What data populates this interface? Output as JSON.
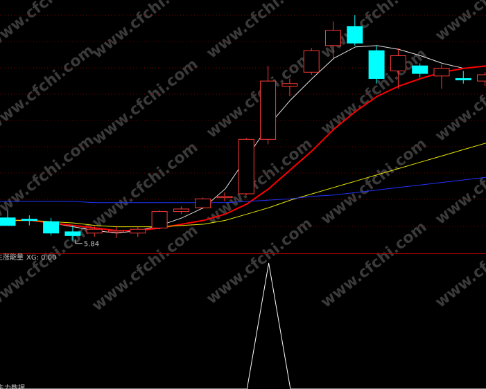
{
  "watermark": "www.cfchi.com",
  "colors": {
    "background": "#000000",
    "grid": "#7a0000",
    "separator": "#b00000",
    "up_candle": "#ff3a3a",
    "down_candle": "#00ffff",
    "ma_white": "#e6e6e6",
    "ma_red": "#ff0000",
    "ma_yellow": "#e8e800",
    "ma_blue": "#2233ff",
    "indicator": "#ffffff"
  },
  "chart_data": [
    {
      "type": "candlestick",
      "low_marker": "5.84",
      "candles": [
        {
          "o": 6.02,
          "h": 6.08,
          "l": 5.98,
          "c": 5.96
        },
        {
          "o": 6.01,
          "h": 6.04,
          "l": 5.96,
          "c": 6.0
        },
        {
          "o": 5.99,
          "h": 6.02,
          "l": 5.88,
          "c": 5.9
        },
        {
          "o": 5.91,
          "h": 5.96,
          "l": 5.84,
          "c": 5.88
        },
        {
          "o": 5.9,
          "h": 5.95,
          "l": 5.87,
          "c": 5.93
        },
        {
          "o": 5.92,
          "h": 5.95,
          "l": 5.86,
          "c": 5.92
        },
        {
          "o": 5.9,
          "h": 5.95,
          "l": 5.87,
          "c": 5.93
        },
        {
          "o": 5.94,
          "h": 6.08,
          "l": 5.93,
          "c": 6.07
        },
        {
          "o": 6.07,
          "h": 6.11,
          "l": 6.05,
          "c": 6.09
        },
        {
          "o": 6.1,
          "h": 6.18,
          "l": 6.09,
          "c": 6.17
        },
        {
          "o": 6.18,
          "h": 6.22,
          "l": 6.15,
          "c": 6.19
        },
        {
          "o": 6.21,
          "h": 6.65,
          "l": 6.2,
          "c": 6.64
        },
        {
          "o": 6.64,
          "h": 7.22,
          "l": 6.6,
          "c": 7.1
        },
        {
          "o": 7.06,
          "h": 7.12,
          "l": 6.98,
          "c": 7.08
        },
        {
          "o": 7.17,
          "h": 7.36,
          "l": 7.15,
          "c": 7.34
        },
        {
          "o": 7.38,
          "h": 7.57,
          "l": 7.28,
          "c": 7.5
        },
        {
          "o": 7.53,
          "h": 7.62,
          "l": 7.38,
          "c": 7.4
        },
        {
          "o": 7.34,
          "h": 7.38,
          "l": 7.08,
          "c": 7.12
        },
        {
          "o": 7.18,
          "h": 7.36,
          "l": 7.04,
          "c": 7.3
        },
        {
          "o": 7.22,
          "h": 7.24,
          "l": 7.13,
          "c": 7.16
        },
        {
          "o": 7.14,
          "h": 7.23,
          "l": 7.04,
          "c": 7.2
        },
        {
          "o": 7.12,
          "h": 7.18,
          "l": 7.08,
          "c": 7.11
        },
        {
          "o": 7.1,
          "h": 7.17,
          "l": 7.06,
          "c": 7.15
        },
        {
          "o": 7.2,
          "h": 7.34,
          "l": 7.12,
          "c": 7.31
        }
      ],
      "moving_averages": [
        {
          "color": "#e6e6e6",
          "values": [
            6.0,
            6.0,
            5.98,
            5.95,
            5.92,
            5.9,
            5.92,
            5.96,
            6.02,
            6.1,
            6.25,
            6.5,
            6.75,
            6.95,
            7.12,
            7.28,
            7.37,
            7.38,
            7.35,
            7.3,
            7.24,
            7.2,
            7.22,
            7.26
          ]
        },
        {
          "color": "#ff0000",
          "values": [
            6.0,
            6.0,
            5.98,
            5.96,
            5.94,
            5.92,
            5.92,
            5.94,
            5.97,
            6.0,
            6.05,
            6.13,
            6.25,
            6.4,
            6.55,
            6.72,
            6.86,
            6.98,
            7.06,
            7.12,
            7.17,
            7.2,
            7.22,
            7.24
          ]
        },
        {
          "color": "#e8e800",
          "values": [
            6.0,
            6.0,
            5.99,
            5.98,
            5.96,
            5.95,
            5.95,
            5.95,
            5.96,
            5.97,
            6.0,
            6.05,
            6.1,
            6.16,
            6.21,
            6.26,
            6.31,
            6.36,
            6.41,
            6.46,
            6.51,
            6.56,
            6.61,
            6.72
          ]
        },
        {
          "color": "#2233ff",
          "values": [
            6.15,
            6.15,
            6.15,
            6.15,
            6.14,
            6.14,
            6.14,
            6.14,
            6.14,
            6.14,
            6.14,
            6.15,
            6.16,
            6.17,
            6.19,
            6.2,
            6.22,
            6.24,
            6.26,
            6.28,
            6.3,
            6.32,
            6.34,
            6.36
          ]
        }
      ],
      "ylim": [
        5.74,
        7.74
      ]
    },
    {
      "type": "line",
      "legend_name": "主涨能量",
      "legend_value": "XG: 0.00",
      "bottom_label": "主力数据",
      "values": [
        0,
        0,
        0,
        0,
        0,
        0,
        0,
        0,
        0,
        0,
        0,
        0,
        1,
        0,
        0,
        0,
        0,
        0,
        0,
        0,
        0,
        0,
        0,
        0
      ],
      "ylim": [
        0,
        1
      ]
    }
  ]
}
